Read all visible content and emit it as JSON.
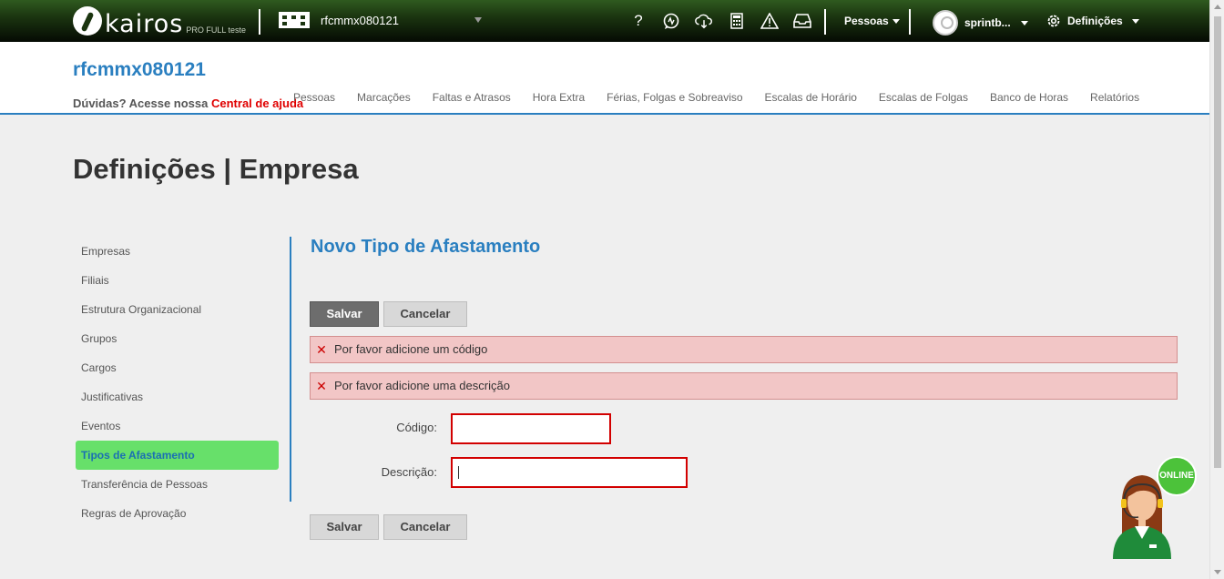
{
  "topbar": {
    "logo_text": "kairos",
    "logo_sub": "PRO FULL teste",
    "company_selector": "rfcmmx080121",
    "pessoas_label": "Pessoas",
    "user_label": "sprintb...",
    "definicoes_label": "Definições",
    "icons": [
      "help-icon",
      "chat-icon",
      "cloud-download-icon",
      "calculator-icon",
      "warning-icon",
      "inbox-icon"
    ]
  },
  "header": {
    "company_title": "rfcmmx080121",
    "help_text": "Dúvidas? Acesse nossa",
    "help_link": "Central de ajuda",
    "nav": [
      "Pessoas",
      "Marcações",
      "Faltas e Atrasos",
      "Hora Extra",
      "Férias, Folgas e Sobreaviso",
      "Escalas de Horário",
      "Escalas de Folgas",
      "Banco de Horas",
      "Relatórios"
    ]
  },
  "page_title": "Definições | Empresa",
  "sidebar": {
    "items": [
      {
        "label": "Empresas"
      },
      {
        "label": "Filiais"
      },
      {
        "label": "Estrutura Organizacional"
      },
      {
        "label": "Grupos"
      },
      {
        "label": "Cargos"
      },
      {
        "label": "Justificativas"
      },
      {
        "label": "Eventos"
      },
      {
        "label": "Tipos de Afastamento"
      },
      {
        "label": "Transferência de Pessoas"
      },
      {
        "label": "Regras de Aprovação"
      }
    ],
    "active_index": 7
  },
  "form": {
    "title": "Novo Tipo de Afastamento",
    "save_label": "Salvar",
    "cancel_label": "Cancelar",
    "errors": [
      "Por favor adicione um código",
      "Por favor adicione uma descrição"
    ],
    "codigo_label": "Código:",
    "codigo_value": "",
    "descricao_label": "Descrição:",
    "descricao_value": ""
  },
  "online_badge": "ONLINE",
  "colors": {
    "topbar": "#1b3510",
    "accent_blue": "#2a7fc0",
    "active_green": "#67e06a",
    "error_bg": "#f2c6c6",
    "error_border": "#d20000",
    "help_link": "#e00000"
  }
}
